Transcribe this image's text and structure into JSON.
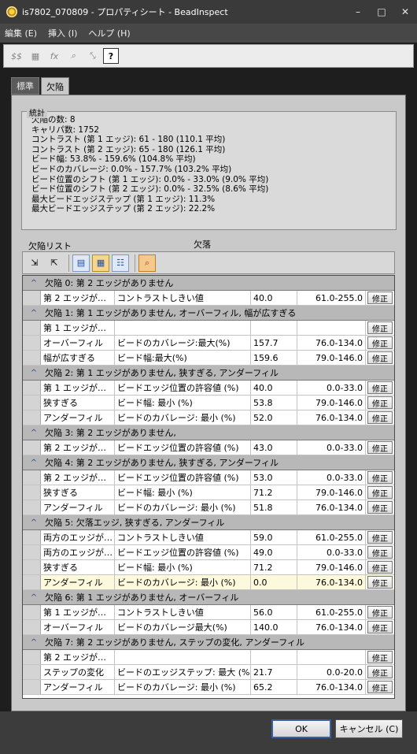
{
  "window": {
    "title": "is7802_070809 - プロパティシート - BeadInspect",
    "controls": [
      "–",
      "□",
      "✕"
    ]
  },
  "menu": [
    "編集 (E)",
    "挿入 (I)",
    "ヘルプ (H)"
  ],
  "toolbar": [
    "$$",
    "▦",
    "fx",
    "⌕",
    "⤡",
    "?"
  ],
  "tabs": [
    "標準",
    "欠陥"
  ],
  "stats": {
    "legend": "統計",
    "lines": [
      "欠陥の数: 8",
      "キャリパ数: 1752",
      "コントラスト (第 1 エッジ): 61 - 180 (110.1 平均)",
      "コントラスト (第 2 エッジ): 65 - 180 (126.1 平均)",
      "ビード幅: 53.8% - 159.6% (104.8% 平均)",
      "ビードのカバレージ: 0.0% - 157.7% (103.2% 平均)",
      "ビード位置のシフト (第 1 エッジ): 0.0% - 33.0% (9.0% 平均)",
      "ビード位置のシフト (第 2 エッジ): 0.0% - 32.5% (8.6% 平均)",
      "最大ビードエッジステップ (第 1 エッジ): 11.3%",
      "最大ビードエッジステップ (第 2 エッジ): 22.2%"
    ]
  },
  "list_label": "欠陥リスト",
  "kekkan_label": "欠落",
  "fix_label": "修正",
  "groups": [
    {
      "header": "欠陥 0: 第 2 エッジがありません",
      "rows": [
        {
          "a": "第 2 エッジが…",
          "b": "コントラストしきい値",
          "c": "40.0",
          "d": "61.0-255.0"
        }
      ]
    },
    {
      "header": "欠陥 1: 第 1 エッジがありません, オーバーフィル, 幅が広すぎる",
      "rows": [
        {
          "a": "第 1 エッジが…",
          "b": "",
          "c": "",
          "d": ""
        },
        {
          "a": "オーバーフィル",
          "b": "ビードのカバレージ:最大(%)",
          "c": "157.7",
          "d": "76.0-134.0"
        },
        {
          "a": "幅が広すぎる",
          "b": "ビード幅:最大(%)",
          "c": "159.6",
          "d": "79.0-146.0"
        }
      ]
    },
    {
      "header": "欠陥 2: 第 1 エッジがありません, 狭すぎる, アンダーフィル",
      "rows": [
        {
          "a": "第 1 エッジが…",
          "b": "ビードエッジ位置の許容値 (%)",
          "c": "40.0",
          "d": "0.0-33.0"
        },
        {
          "a": "狭すぎる",
          "b": "ビード幅: 最小 (%)",
          "c": "53.8",
          "d": "79.0-146.0"
        },
        {
          "a": "アンダーフィル",
          "b": "ビードのカバレージ: 最小 (%)",
          "c": "52.0",
          "d": "76.0-134.0"
        }
      ]
    },
    {
      "header": "欠陥 3: 第 2 エッジがありません,",
      "rows": [
        {
          "a": "第 2 エッジが…",
          "b": "ビードエッジ位置の許容値 (%)",
          "c": "43.0",
          "d": "0.0-33.0"
        }
      ]
    },
    {
      "header": "欠陥 4: 第 2 エッジがありません, 狭すぎる, アンダーフィル",
      "rows": [
        {
          "a": "第 2 エッジが…",
          "b": "ビードエッジ位置の許容値 (%)",
          "c": "53.0",
          "d": "0.0-33.0"
        },
        {
          "a": "狭すぎる",
          "b": "ビード幅: 最小 (%)",
          "c": "71.2",
          "d": "79.0-146.0"
        },
        {
          "a": "アンダーフィル",
          "b": "ビードのカバレージ: 最小 (%)",
          "c": "51.8",
          "d": "76.0-134.0"
        }
      ]
    },
    {
      "header": "欠陥 5: 欠落エッジ, 狭すぎる, アンダーフィル",
      "rows": [
        {
          "a": "両方のエッジが…",
          "b": "コントラストしきい値",
          "c": "59.0",
          "d": "61.0-255.0"
        },
        {
          "a": "両方のエッジが…",
          "b": "ビードエッジ位置の許容値 (%)",
          "c": "49.0",
          "d": "0.0-33.0"
        },
        {
          "a": "狭すぎる",
          "b": "ビード幅: 最小 (%)",
          "c": "71.2",
          "d": "79.0-146.0"
        },
        {
          "a": "アンダーフィル",
          "b": "ビードのカバレージ: 最小 (%)",
          "c": "0.0",
          "d": "76.0-134.0",
          "highlight": true
        }
      ]
    },
    {
      "header": "欠陥 6: 第 1 エッジがありません, オーバーフィル",
      "rows": [
        {
          "a": "第 1 エッジが…",
          "b": "コントラストしきい値",
          "c": "56.0",
          "d": "61.0-255.0"
        },
        {
          "a": "オーバーフィル",
          "b": "ビードのカバレージ最大(%)",
          "c": "140.0",
          "d": "76.0-134.0"
        }
      ]
    },
    {
      "header": "欠陥 7: 第 2 エッジがありません, ステップの変化, アンダーフィル",
      "rows": [
        {
          "a": "第 2 エッジが…",
          "b": "",
          "c": "",
          "d": ""
        },
        {
          "a": "ステップの変化",
          "b": "ビードのエッジステップ: 最大 (%)",
          "c": "21.7",
          "d": "0.0-20.0"
        },
        {
          "a": "アンダーフィル",
          "b": "ビードのカバレージ: 最小 (%)",
          "c": "65.2",
          "d": "76.0-134.0"
        }
      ]
    }
  ],
  "buttons": {
    "ok": "OK",
    "cancel": "キャンセル (C)"
  }
}
